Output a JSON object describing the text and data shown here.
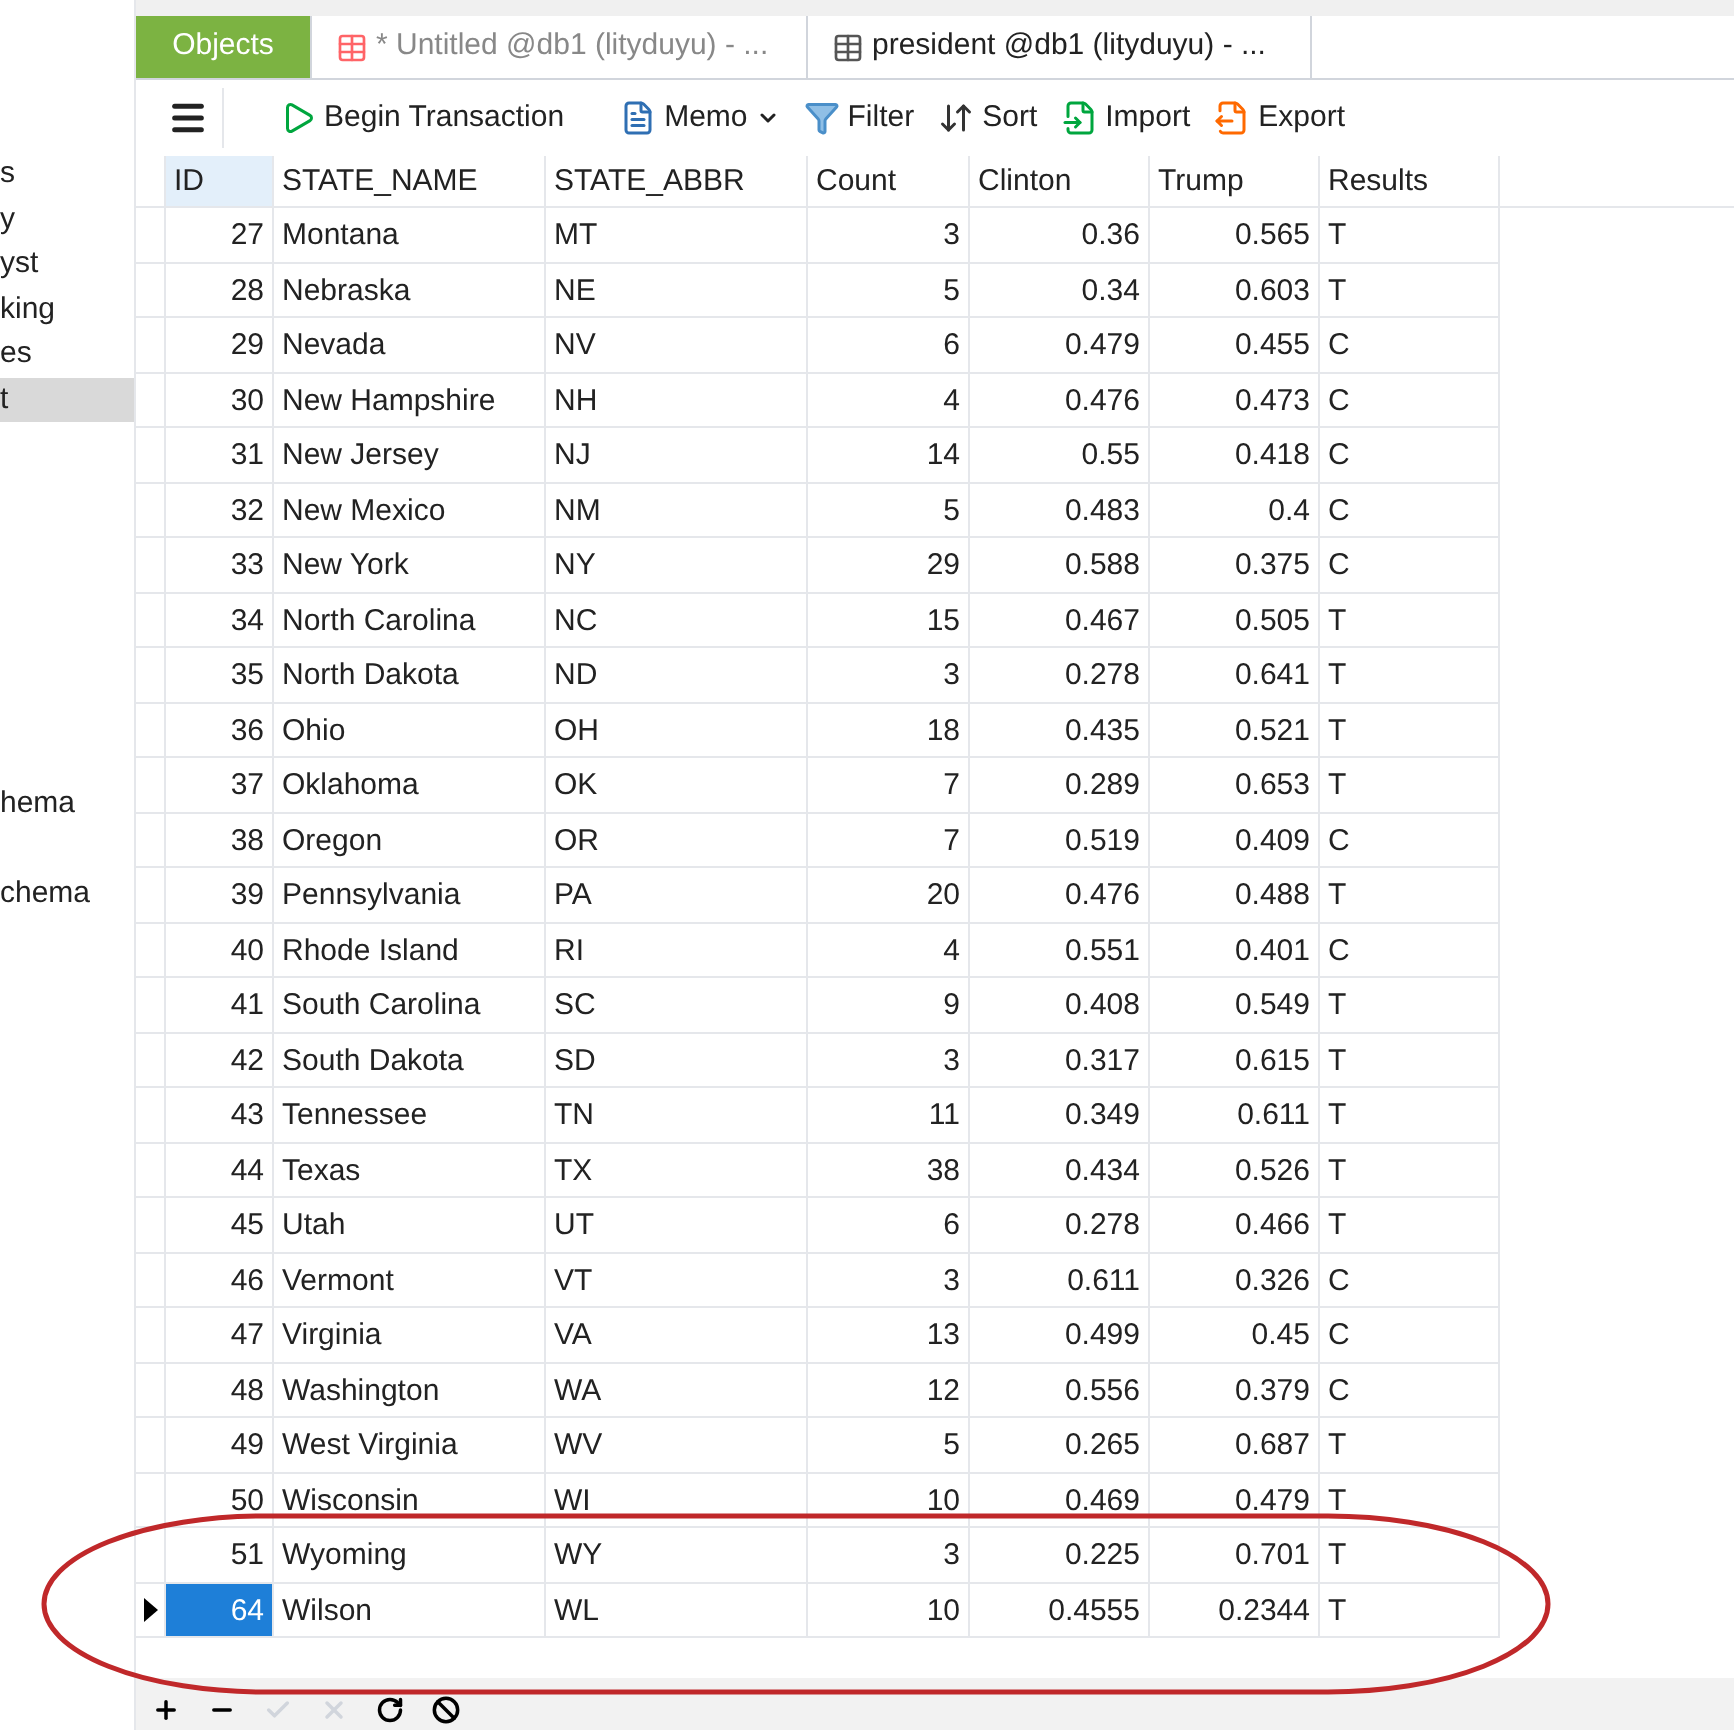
{
  "sidebar": {
    "groups": [
      [
        {
          "label": "s",
          "selected": false
        },
        {
          "label": "y",
          "selected": false
        },
        {
          "label": "yst",
          "selected": false
        },
        {
          "label": "king",
          "selected": false
        },
        {
          "label": "es",
          "selected": false
        },
        {
          "label": "t",
          "selected": true
        }
      ],
      [
        {
          "label": "hema",
          "selected": false
        }
      ],
      [
        {
          "label": "chema",
          "selected": false
        }
      ]
    ]
  },
  "tabs": [
    {
      "kind": "objects",
      "label": "Objects",
      "selected": true
    },
    {
      "kind": "query",
      "label": "* Untitled @db1 (lityduyu) - ...",
      "selected": false
    },
    {
      "kind": "table",
      "label": "president @db1 (lityduyu) - ...",
      "selected": false
    }
  ],
  "toolbar": [
    {
      "kind": "transaction",
      "label": "Begin Transaction"
    },
    {
      "kind": "memo",
      "label": "Memo"
    },
    {
      "kind": "filter",
      "label": "Filter"
    },
    {
      "kind": "sort",
      "label": "Sort"
    },
    {
      "kind": "import",
      "label": "Import"
    },
    {
      "kind": "export",
      "label": "Export"
    }
  ],
  "table": {
    "columns": [
      "ID",
      "STATE_NAME",
      "STATE_ABBR",
      "Count",
      "Clinton",
      "Trump",
      "Results"
    ],
    "rows": [
      {
        "cells": [
          "27",
          "Montana",
          "MT",
          "3",
          "0.36",
          "0.565",
          "T"
        ],
        "selected": false
      },
      {
        "cells": [
          "28",
          "Nebraska",
          "NE",
          "5",
          "0.34",
          "0.603",
          "T"
        ],
        "selected": false
      },
      {
        "cells": [
          "29",
          "Nevada",
          "NV",
          "6",
          "0.479",
          "0.455",
          "C"
        ],
        "selected": false
      },
      {
        "cells": [
          "30",
          "New Hampshire",
          "NH",
          "4",
          "0.476",
          "0.473",
          "C"
        ],
        "selected": false
      },
      {
        "cells": [
          "31",
          "New Jersey",
          "NJ",
          "14",
          "0.55",
          "0.418",
          "C"
        ],
        "selected": false
      },
      {
        "cells": [
          "32",
          "New Mexico",
          "NM",
          "5",
          "0.483",
          "0.4",
          "C"
        ],
        "selected": false
      },
      {
        "cells": [
          "33",
          "New York",
          "NY",
          "29",
          "0.588",
          "0.375",
          "C"
        ],
        "selected": false
      },
      {
        "cells": [
          "34",
          "North Carolina",
          "NC",
          "15",
          "0.467",
          "0.505",
          "T"
        ],
        "selected": false
      },
      {
        "cells": [
          "35",
          "North Dakota",
          "ND",
          "3",
          "0.278",
          "0.641",
          "T"
        ],
        "selected": false
      },
      {
        "cells": [
          "36",
          "Ohio",
          "OH",
          "18",
          "0.435",
          "0.521",
          "T"
        ],
        "selected": false
      },
      {
        "cells": [
          "37",
          "Oklahoma",
          "OK",
          "7",
          "0.289",
          "0.653",
          "T"
        ],
        "selected": false
      },
      {
        "cells": [
          "38",
          "Oregon",
          "OR",
          "7",
          "0.519",
          "0.409",
          "C"
        ],
        "selected": false
      },
      {
        "cells": [
          "39",
          "Pennsylvania",
          "PA",
          "20",
          "0.476",
          "0.488",
          "T"
        ],
        "selected": false
      },
      {
        "cells": [
          "40",
          "Rhode Island",
          "RI",
          "4",
          "0.551",
          "0.401",
          "C"
        ],
        "selected": false
      },
      {
        "cells": [
          "41",
          "South Carolina",
          "SC",
          "9",
          "0.408",
          "0.549",
          "T"
        ],
        "selected": false
      },
      {
        "cells": [
          "42",
          "South Dakota",
          "SD",
          "3",
          "0.317",
          "0.615",
          "T"
        ],
        "selected": false
      },
      {
        "cells": [
          "43",
          "Tennessee",
          "TN",
          "11",
          "0.349",
          "0.611",
          "T"
        ],
        "selected": false
      },
      {
        "cells": [
          "44",
          "Texas",
          "TX",
          "38",
          "0.434",
          "0.526",
          "T"
        ],
        "selected": false
      },
      {
        "cells": [
          "45",
          "Utah",
          "UT",
          "6",
          "0.278",
          "0.466",
          "T"
        ],
        "selected": false
      },
      {
        "cells": [
          "46",
          "Vermont",
          "VT",
          "3",
          "0.611",
          "0.326",
          "C"
        ],
        "selected": false
      },
      {
        "cells": [
          "47",
          "Virginia",
          "VA",
          "13",
          "0.499",
          "0.45",
          "C"
        ],
        "selected": false
      },
      {
        "cells": [
          "48",
          "Washington",
          "WA",
          "12",
          "0.556",
          "0.379",
          "C"
        ],
        "selected": false
      },
      {
        "cells": [
          "49",
          "West Virginia",
          "WV",
          "5",
          "0.265",
          "0.687",
          "T"
        ],
        "selected": false
      },
      {
        "cells": [
          "50",
          "Wisconsin",
          "WI",
          "10",
          "0.469",
          "0.479",
          "T"
        ],
        "selected": false
      },
      {
        "cells": [
          "51",
          "Wyoming",
          "WY",
          "3",
          "0.225",
          "0.701",
          "T"
        ],
        "selected": false
      },
      {
        "cells": [
          "64",
          "Wilson",
          "WL",
          "10",
          "0.4555",
          "0.2344",
          "T"
        ],
        "selected": true
      }
    ]
  },
  "bottom_bar": [
    {
      "kind": "add",
      "disabled": false
    },
    {
      "kind": "remove",
      "disabled": false
    },
    {
      "kind": "apply",
      "disabled": true
    },
    {
      "kind": "discard",
      "disabled": true
    },
    {
      "kind": "refresh",
      "disabled": false
    },
    {
      "kind": "stop",
      "disabled": false
    }
  ]
}
